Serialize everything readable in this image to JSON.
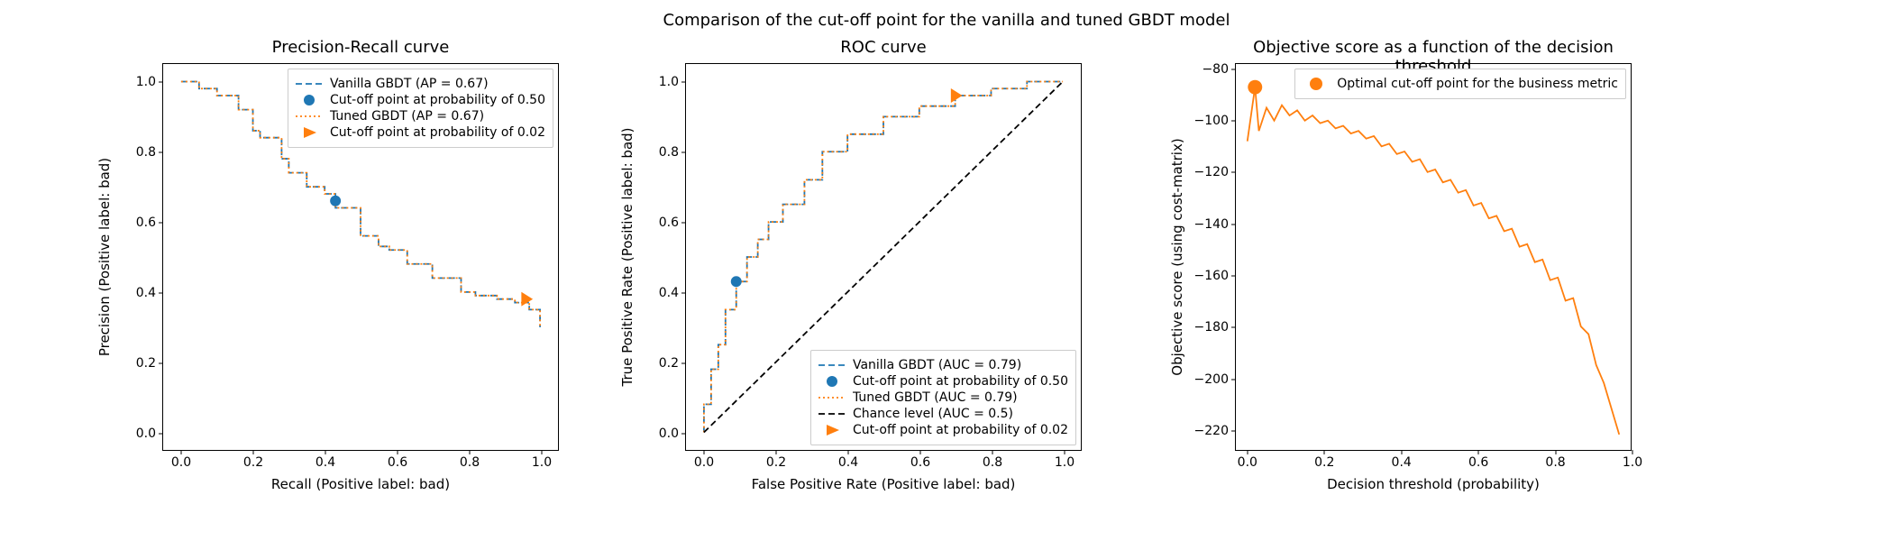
{
  "suptitle": "Comparison of the cut-off point for the vanilla and tuned GBDT model",
  "colors": {
    "blue": "#1f77b4",
    "orange": "#ff7f0e",
    "black": "#000000"
  },
  "chart_data": [
    {
      "type": "line",
      "title": "Precision-Recall curve",
      "xlabel": "Recall (Positive label: bad)",
      "ylabel": "Precision (Positive label: bad)",
      "xlim": [
        -0.05,
        1.05
      ],
      "ylim": [
        -0.05,
        1.05
      ],
      "xticks": [
        0.0,
        0.2,
        0.4,
        0.6,
        0.8,
        1.0
      ],
      "yticks": [
        0.0,
        0.2,
        0.4,
        0.6,
        0.8,
        1.0
      ],
      "series": [
        {
          "name": "Vanilla GBDT (AP = 0.67)",
          "style": "blue-dashed",
          "x": [
            0.0,
            0.05,
            0.05,
            0.1,
            0.1,
            0.16,
            0.16,
            0.2,
            0.2,
            0.22,
            0.22,
            0.28,
            0.28,
            0.3,
            0.3,
            0.35,
            0.35,
            0.4,
            0.4,
            0.43,
            0.43,
            0.5,
            0.5,
            0.55,
            0.55,
            0.58,
            0.58,
            0.63,
            0.63,
            0.7,
            0.7,
            0.78,
            0.78,
            0.82,
            0.82,
            0.88,
            0.88,
            0.93,
            0.93,
            0.97,
            0.97,
            1.0,
            1.0
          ],
          "y": [
            1.0,
            1.0,
            0.98,
            0.98,
            0.96,
            0.96,
            0.92,
            0.92,
            0.86,
            0.86,
            0.84,
            0.84,
            0.78,
            0.78,
            0.74,
            0.74,
            0.7,
            0.7,
            0.68,
            0.68,
            0.64,
            0.64,
            0.56,
            0.56,
            0.53,
            0.53,
            0.52,
            0.52,
            0.48,
            0.48,
            0.44,
            0.44,
            0.4,
            0.4,
            0.39,
            0.39,
            0.38,
            0.38,
            0.37,
            0.37,
            0.35,
            0.35,
            0.3
          ]
        },
        {
          "name": "Tuned GBDT (AP = 0.67)",
          "style": "orange-dotted",
          "x": [
            0.0,
            0.05,
            0.05,
            0.1,
            0.1,
            0.16,
            0.16,
            0.2,
            0.2,
            0.22,
            0.22,
            0.28,
            0.28,
            0.3,
            0.3,
            0.35,
            0.35,
            0.4,
            0.4,
            0.43,
            0.43,
            0.5,
            0.5,
            0.55,
            0.55,
            0.58,
            0.58,
            0.63,
            0.63,
            0.7,
            0.7,
            0.78,
            0.78,
            0.82,
            0.82,
            0.88,
            0.88,
            0.93,
            0.93,
            0.97,
            0.97,
            1.0,
            1.0
          ],
          "y": [
            1.0,
            1.0,
            0.98,
            0.98,
            0.96,
            0.96,
            0.92,
            0.92,
            0.86,
            0.86,
            0.84,
            0.84,
            0.78,
            0.78,
            0.74,
            0.74,
            0.7,
            0.7,
            0.68,
            0.68,
            0.64,
            0.64,
            0.56,
            0.56,
            0.53,
            0.53,
            0.52,
            0.52,
            0.48,
            0.48,
            0.44,
            0.44,
            0.4,
            0.4,
            0.39,
            0.39,
            0.38,
            0.38,
            0.37,
            0.37,
            0.35,
            0.35,
            0.3
          ]
        }
      ],
      "markers": [
        {
          "name": "Cut-off point at probability of 0.50",
          "shape": "circle",
          "color": "#1f77b4",
          "x": 0.43,
          "y": 0.66
        },
        {
          "name": "Cut-off point at probability of 0.02",
          "shape": "triangle-right",
          "color": "#ff7f0e",
          "x": 0.96,
          "y": 0.38
        }
      ],
      "legend": {
        "position": "upper-right",
        "entries": [
          {
            "label": "Vanilla GBDT (AP = 0.67)",
            "style": "blue-dashed"
          },
          {
            "label": "Cut-off point at probability of 0.50",
            "style": "blue-circle"
          },
          {
            "label": "Tuned GBDT (AP = 0.67)",
            "style": "orange-dotted"
          },
          {
            "label": "Cut-off point at probability of 0.02",
            "style": "orange-triangle"
          }
        ]
      }
    },
    {
      "type": "line",
      "title": "ROC curve",
      "xlabel": "False Positive Rate (Positive label: bad)",
      "ylabel": "True Positive Rate (Positive label: bad)",
      "xlim": [
        -0.05,
        1.05
      ],
      "ylim": [
        -0.05,
        1.05
      ],
      "xticks": [
        0.0,
        0.2,
        0.4,
        0.6,
        0.8,
        1.0
      ],
      "yticks": [
        0.0,
        0.2,
        0.4,
        0.6,
        0.8,
        1.0
      ],
      "series": [
        {
          "name": "Vanilla GBDT (AUC = 0.79)",
          "style": "blue-dashed",
          "x": [
            0.0,
            0.0,
            0.02,
            0.02,
            0.04,
            0.04,
            0.06,
            0.06,
            0.09,
            0.09,
            0.12,
            0.12,
            0.15,
            0.15,
            0.18,
            0.18,
            0.22,
            0.22,
            0.28,
            0.28,
            0.33,
            0.33,
            0.4,
            0.4,
            0.5,
            0.5,
            0.6,
            0.6,
            0.7,
            0.7,
            0.8,
            0.8,
            0.9,
            0.9,
            1.0
          ],
          "y": [
            0.0,
            0.08,
            0.08,
            0.18,
            0.18,
            0.25,
            0.25,
            0.35,
            0.35,
            0.43,
            0.43,
            0.5,
            0.5,
            0.55,
            0.55,
            0.6,
            0.6,
            0.65,
            0.65,
            0.72,
            0.72,
            0.8,
            0.8,
            0.85,
            0.85,
            0.9,
            0.9,
            0.93,
            0.93,
            0.96,
            0.96,
            0.98,
            0.98,
            1.0,
            1.0
          ]
        },
        {
          "name": "Tuned GBDT (AUC = 0.79)",
          "style": "orange-dotted",
          "x": [
            0.0,
            0.0,
            0.02,
            0.02,
            0.04,
            0.04,
            0.06,
            0.06,
            0.09,
            0.09,
            0.12,
            0.12,
            0.15,
            0.15,
            0.18,
            0.18,
            0.22,
            0.22,
            0.28,
            0.28,
            0.33,
            0.33,
            0.4,
            0.4,
            0.5,
            0.5,
            0.6,
            0.6,
            0.7,
            0.7,
            0.8,
            0.8,
            0.9,
            0.9,
            1.0
          ],
          "y": [
            0.0,
            0.08,
            0.08,
            0.18,
            0.18,
            0.25,
            0.25,
            0.35,
            0.35,
            0.43,
            0.43,
            0.5,
            0.5,
            0.55,
            0.55,
            0.6,
            0.6,
            0.65,
            0.65,
            0.72,
            0.72,
            0.8,
            0.8,
            0.85,
            0.85,
            0.9,
            0.9,
            0.93,
            0.93,
            0.96,
            0.96,
            0.98,
            0.98,
            1.0,
            1.0
          ]
        },
        {
          "name": "Chance level (AUC = 0.5)",
          "style": "black-dashed",
          "x": [
            0.0,
            1.0
          ],
          "y": [
            0.0,
            1.0
          ]
        }
      ],
      "markers": [
        {
          "name": "Cut-off point at probability of 0.50",
          "shape": "circle",
          "color": "#1f77b4",
          "x": 0.09,
          "y": 0.43
        },
        {
          "name": "Cut-off point at probability of 0.02",
          "shape": "triangle-right",
          "color": "#ff7f0e",
          "x": 0.7,
          "y": 0.96
        }
      ],
      "legend": {
        "position": "lower-right",
        "entries": [
          {
            "label": "Vanilla GBDT (AUC = 0.79)",
            "style": "blue-dashed"
          },
          {
            "label": "Cut-off point at probability of 0.50",
            "style": "blue-circle"
          },
          {
            "label": "Tuned GBDT (AUC = 0.79)",
            "style": "orange-dotted"
          },
          {
            "label": "Chance level (AUC = 0.5)",
            "style": "black-dashed"
          },
          {
            "label": "Cut-off point at probability of 0.02",
            "style": "orange-triangle"
          }
        ]
      }
    },
    {
      "type": "line",
      "title": "Objective score as a function of the decision threshold",
      "xlabel": "Decision threshold (probability)",
      "ylabel": "Objective score (using cost-matrix)",
      "xlim": [
        -0.03,
        1.0
      ],
      "ylim": [
        -228,
        -78
      ],
      "xticks": [
        0.0,
        0.2,
        0.4,
        0.6,
        0.8,
        1.0
      ],
      "yticks": [
        -220,
        -200,
        -180,
        -160,
        -140,
        -120,
        -100,
        -80
      ],
      "series": [
        {
          "name": "Objective score",
          "style": "orange-solid",
          "x": [
            0.0,
            0.02,
            0.03,
            0.05,
            0.07,
            0.09,
            0.11,
            0.13,
            0.15,
            0.17,
            0.19,
            0.21,
            0.23,
            0.25,
            0.27,
            0.29,
            0.31,
            0.33,
            0.35,
            0.37,
            0.39,
            0.41,
            0.43,
            0.45,
            0.47,
            0.49,
            0.51,
            0.53,
            0.55,
            0.57,
            0.59,
            0.61,
            0.63,
            0.65,
            0.67,
            0.69,
            0.71,
            0.73,
            0.75,
            0.77,
            0.79,
            0.81,
            0.83,
            0.85,
            0.87,
            0.89,
            0.91,
            0.93,
            0.95,
            0.97
          ],
          "y": [
            -108,
            -87,
            -104,
            -95,
            -100,
            -94,
            -98,
            -96,
            -100,
            -98,
            -101,
            -100,
            -103,
            -102,
            -105,
            -104,
            -107,
            -106,
            -110,
            -109,
            -113,
            -112,
            -116,
            -115,
            -120,
            -119,
            -124,
            -123,
            -128,
            -127,
            -133,
            -132,
            -138,
            -137,
            -143,
            -142,
            -149,
            -148,
            -155,
            -154,
            -162,
            -161,
            -170,
            -169,
            -180,
            -183,
            -195,
            -202,
            -212,
            -222
          ]
        }
      ],
      "markers": [
        {
          "name": "Optimal cut-off point for the business metric",
          "shape": "circle-large",
          "color": "#ff7f0e",
          "x": 0.02,
          "y": -87
        }
      ],
      "legend": {
        "position": "upper-right-inset",
        "entries": [
          {
            "label": "Optimal cut-off point for the business metric",
            "style": "orange-circle-large"
          }
        ]
      }
    }
  ]
}
